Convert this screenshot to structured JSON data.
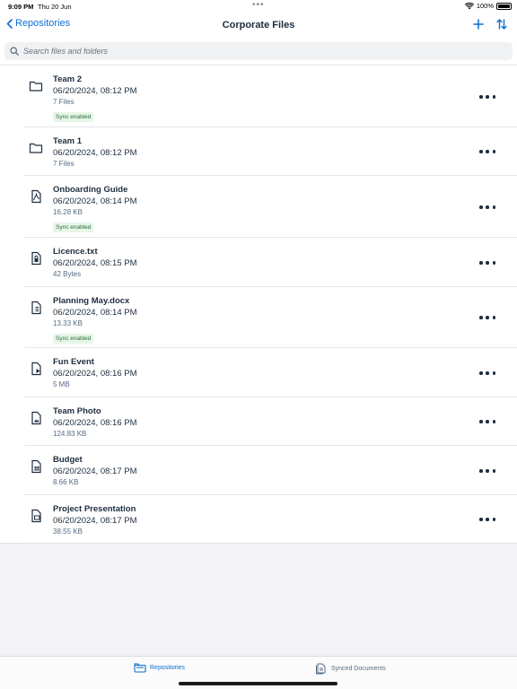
{
  "status_bar": {
    "time": "9:09 PM",
    "date": "Thu 20 Jun",
    "battery": "100%"
  },
  "nav": {
    "back_label": "Repositories",
    "title": "Corporate Files",
    "add_icon": "plus-icon",
    "sort_icon": "sort-icon"
  },
  "search": {
    "placeholder": "Search files and folders",
    "value": ""
  },
  "files": [
    {
      "name": "Team 2",
      "date": "06/20/2024, 08:12 PM",
      "meta": "7 Files",
      "sync": "Sync enabled",
      "icon": "folder-icon"
    },
    {
      "name": "Team 1",
      "date": "06/20/2024, 08:12 PM",
      "meta": "7 Files",
      "sync": "",
      "icon": "folder-icon"
    },
    {
      "name": "Onboarding Guide",
      "date": "06/20/2024, 08:14 PM",
      "meta": "16.28 KB",
      "sync": "Sync enabled",
      "icon": "pdf-file-icon"
    },
    {
      "name": "Licence.txt",
      "date": "06/20/2024, 08:15 PM",
      "meta": "42 Bytes",
      "sync": "",
      "icon": "text-file-icon"
    },
    {
      "name": "Planning May.docx",
      "date": "06/20/2024, 08:14 PM",
      "meta": "13.33 KB",
      "sync": "Sync enabled",
      "icon": "document-file-icon"
    },
    {
      "name": "Fun Event",
      "date": "06/20/2024, 08:16 PM",
      "meta": "5 MB",
      "sync": "",
      "icon": "video-file-icon"
    },
    {
      "name": "Team Photo",
      "date": "06/20/2024, 08:16 PM",
      "meta": "124.83 KB",
      "sync": "",
      "icon": "image-file-icon"
    },
    {
      "name": "Budget",
      "date": "06/20/2024, 08:17 PM",
      "meta": "8.66 KB",
      "sync": "",
      "icon": "spreadsheet-file-icon"
    },
    {
      "name": "Project Presentation",
      "date": "06/20/2024, 08:17 PM",
      "meta": "38.55 KB",
      "sync": "",
      "icon": "presentation-file-icon"
    }
  ],
  "tabs": [
    {
      "label": "Repositories",
      "active": true,
      "icon": "repositories-icon"
    },
    {
      "label": "Synced Documents",
      "active": false,
      "icon": "synced-documents-icon"
    }
  ],
  "colors": {
    "accent": "#0a6ed1",
    "text": "#1d2d3e",
    "sync_badge_bg": "#e7f6e9",
    "sync_badge_text": "#256f3a"
  }
}
